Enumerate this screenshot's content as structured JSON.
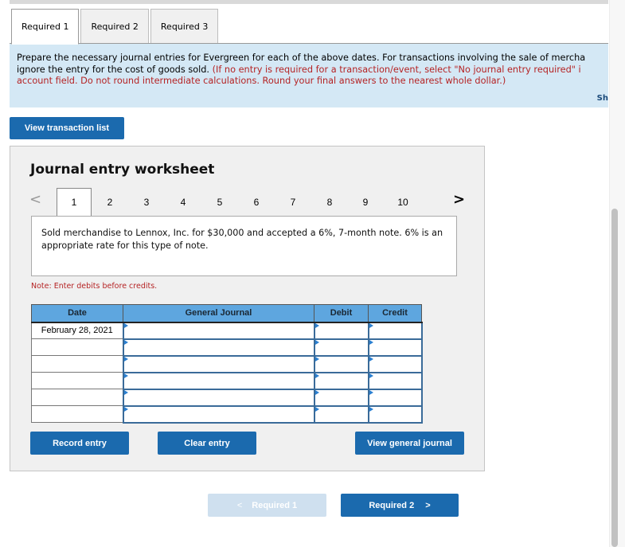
{
  "tabs": [
    {
      "label": "Required 1",
      "active": true
    },
    {
      "label": "Required 2",
      "active": false
    },
    {
      "label": "Required 3",
      "active": false
    }
  ],
  "instructions": {
    "line1": "Prepare the necessary journal entries for Evergreen for each of the above dates. For transactions involving the sale of mercha",
    "line2_black": "ignore the entry for the cost of goods sold. ",
    "line2_red": "(If no entry is required for a transaction/event, select \"No journal entry required\" i",
    "line3_red": "account field. Do not round intermediate calculations. Round your final answers to the nearest whole dollar.)",
    "show_link": "Sh"
  },
  "view_transaction_list": "View transaction list",
  "worksheet": {
    "title": "Journal entry worksheet",
    "pager": {
      "prev": "<",
      "next": ">",
      "pages": [
        "1",
        "2",
        "3",
        "4",
        "5",
        "6",
        "7",
        "8",
        "9",
        "10"
      ],
      "active_page": "1"
    },
    "description": "Sold merchandise to Lennox, Inc. for $30,000 and accepted a 6%, 7-month note. 6% is an appropriate rate for this type of note.",
    "note": "Note: Enter debits before credits.",
    "table": {
      "headers": {
        "date": "Date",
        "general_journal": "General Journal",
        "debit": "Debit",
        "credit": "Credit"
      },
      "rows": [
        {
          "date": "February 28, 2021",
          "account": "",
          "debit": "",
          "credit": ""
        },
        {
          "date": "",
          "account": "",
          "debit": "",
          "credit": ""
        },
        {
          "date": "",
          "account": "",
          "debit": "",
          "credit": ""
        },
        {
          "date": "",
          "account": "",
          "debit": "",
          "credit": ""
        },
        {
          "date": "",
          "account": "",
          "debit": "",
          "credit": ""
        },
        {
          "date": "",
          "account": "",
          "debit": "",
          "credit": ""
        }
      ]
    },
    "buttons": {
      "record": "Record entry",
      "clear": "Clear entry",
      "view_journal": "View general journal"
    }
  },
  "nav": {
    "prev_label": "Required 1",
    "prev_icon": "<",
    "next_label": "Required 2",
    "next_icon": ">"
  }
}
